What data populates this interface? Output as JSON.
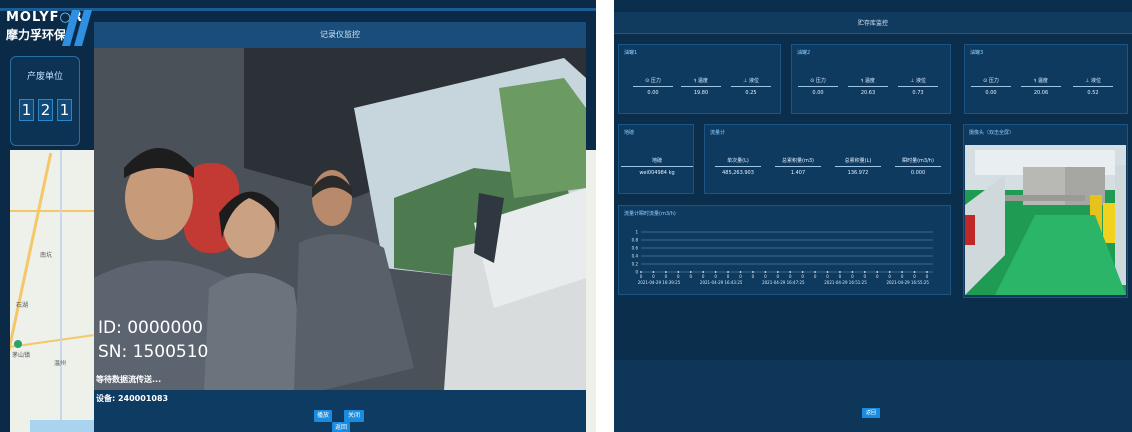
{
  "left": {
    "logo_en": "MOLYF",
    "logo_en2": "R",
    "logo_cn": "摩力孚环保",
    "unit_title": "产废单位",
    "unit_digits": [
      "1",
      "2",
      "1"
    ],
    "modal_title": "记录仪监控",
    "video_id": "ID: 0000000",
    "video_sn": "SN: 1500510",
    "status_text": "等待数据流传送...",
    "device_text": "设备: 240001083",
    "btn_play": "播放",
    "btn_stop": "关闭",
    "btn_back": "返回",
    "map_labels": [
      "茅山镇",
      "温州",
      "南坑",
      "石湖"
    ]
  },
  "right": {
    "title": "贮存库监控",
    "tanks": [
      {
        "name": "油罐1",
        "metrics": [
          {
            "icon": "gauge-icon",
            "label": "压力",
            "value": "0.00"
          },
          {
            "icon": "thermometer-icon",
            "label": "温度",
            "value": "19.80"
          },
          {
            "icon": "level-icon",
            "label": "液位",
            "value": "0.25"
          }
        ]
      },
      {
        "name": "油罐2",
        "metrics": [
          {
            "icon": "gauge-icon",
            "label": "压力",
            "value": "0.00"
          },
          {
            "icon": "thermometer-icon",
            "label": "温度",
            "value": "20.63"
          },
          {
            "icon": "level-icon",
            "label": "液位",
            "value": "0.73"
          }
        ]
      },
      {
        "name": "油罐3",
        "metrics": [
          {
            "icon": "gauge-icon",
            "label": "压力",
            "value": "0.00"
          },
          {
            "icon": "thermometer-icon",
            "label": "温度",
            "value": "20.06"
          },
          {
            "icon": "level-icon",
            "label": "液位",
            "value": "0.52"
          }
        ]
      }
    ],
    "weigh": {
      "title": "地磅",
      "label": "地磅",
      "value": "wei004984 kg"
    },
    "flow": {
      "title": "流量计",
      "items": [
        {
          "label": "单次量(L)",
          "value": "485,263.903"
        },
        {
          "label": "总累积量(m3)",
          "value": "1.407"
        },
        {
          "label": "总累积量(L)",
          "value": "136.972"
        },
        {
          "label": "瞬时量(m3/h)",
          "value": "0.000"
        }
      ]
    },
    "camera_title": "摄像头（双击全屏）",
    "camera_caption": "2021-04-29 ...",
    "return_label": "返回"
  },
  "chart_data": {
    "type": "line",
    "title": "流量计瞬时流量(m3/h)",
    "x": [
      "2021-04-29 16:39:25",
      "2021-04-29 16:43:25",
      "2021-04-29 16:47:25",
      "2021-04-29 16:51:25",
      "2021-04-29 16:55:25"
    ],
    "series": [
      {
        "values": [
          0,
          0,
          0,
          0,
          0
        ]
      }
    ],
    "ylim": [
      0,
      1
    ],
    "yticks": [
      "1",
      "0.8",
      "0.6",
      "0.4",
      "0.2",
      "0"
    ],
    "n_points": 24,
    "grid": true
  }
}
